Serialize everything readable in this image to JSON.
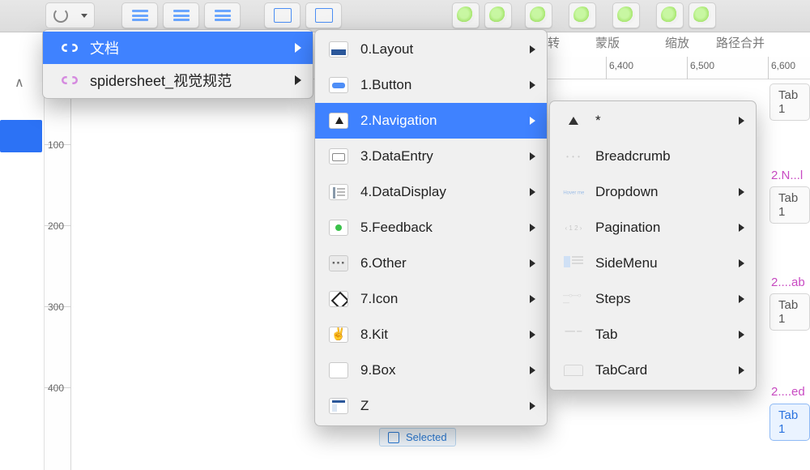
{
  "toolbar": {
    "labels": {
      "zhuan": "转",
      "mask": "蒙版",
      "zoom": "缩放",
      "pathmerge": "路径合并"
    }
  },
  "ruler": {
    "h": [
      "6,400",
      "6,500",
      "6,600"
    ],
    "v": [
      "100",
      "200",
      "300",
      "400"
    ]
  },
  "selected_label": "Selected",
  "menu1": [
    {
      "label": "文档"
    },
    {
      "label": "spidersheet_视觉规范"
    }
  ],
  "menu2": [
    {
      "label": "0.Layout"
    },
    {
      "label": "1.Button"
    },
    {
      "label": "2.Navigation"
    },
    {
      "label": "3.DataEntry"
    },
    {
      "label": "4.DataDisplay"
    },
    {
      "label": "5.Feedback"
    },
    {
      "label": "6.Other"
    },
    {
      "label": "7.Icon"
    },
    {
      "label": "8.Kit"
    },
    {
      "label": "9.Box"
    },
    {
      "label": "Z"
    }
  ],
  "menu3": [
    {
      "label": "*"
    },
    {
      "label": "Breadcrumb"
    },
    {
      "label": "Dropdown"
    },
    {
      "label": "Pagination"
    },
    {
      "label": "SideMenu"
    },
    {
      "label": "Steps"
    },
    {
      "label": "Tab"
    },
    {
      "label": "TabCard"
    }
  ],
  "crumbs": {
    "c1": "2.N...l",
    "c2": "2....ab",
    "c3": "2....ed"
  },
  "tabchips": {
    "t0": "Tab 1",
    "t1": "Tab 1",
    "t2": "Tab 1",
    "t3": "Tab 1"
  }
}
